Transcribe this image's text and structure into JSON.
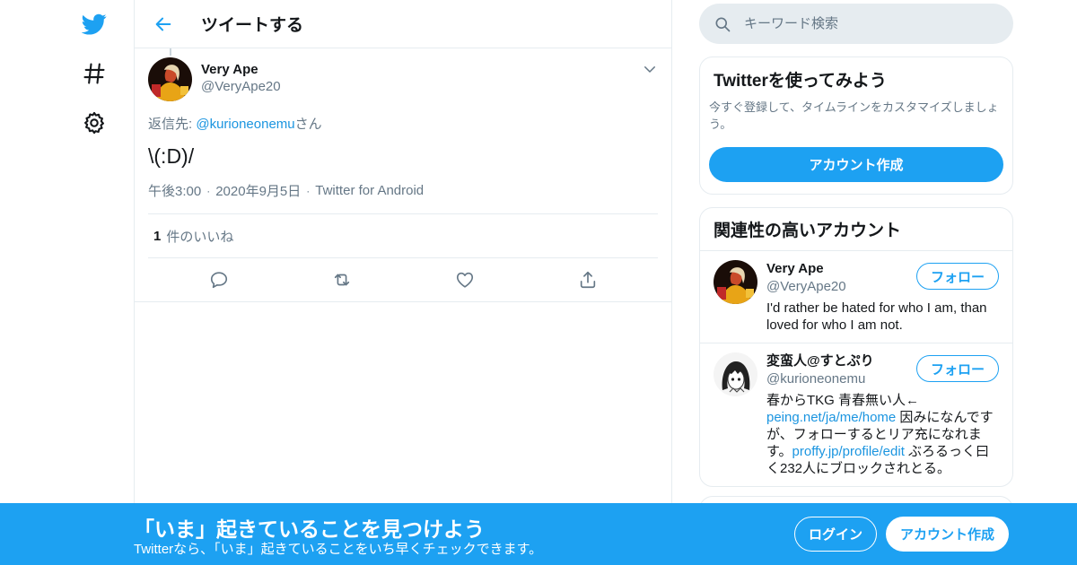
{
  "colors": {
    "accent": "#1da1f2",
    "link": "#1b95e0",
    "muted": "#657786",
    "border": "#e6ecf0"
  },
  "nav": {
    "icons": [
      "twitter-logo-icon",
      "hashtag-icon",
      "gear-icon"
    ]
  },
  "header": {
    "title": "ツイートする"
  },
  "tweet": {
    "author_name": "Very Ape",
    "author_handle": "@VeryApe20",
    "reply_prefix": "返信先: ",
    "reply_mention": "@kurioneonemu",
    "reply_suffix": "さん",
    "text": "\\(:D)/",
    "time": "午後3:00",
    "date": "2020年9月5日",
    "source": "Twitter for Android",
    "likes_count": "1",
    "likes_label": "件のいいね"
  },
  "sidebar": {
    "search_placeholder": "キーワード検索",
    "signup_card": {
      "title": "Twitterを使ってみよう",
      "description": "今すぐ登録して、タイムラインをカスタマイズしましょう。",
      "button": "アカウント作成"
    },
    "related": {
      "title": "関連性の高いアカウント",
      "accounts": [
        {
          "name": "Very Ape",
          "handle": "@VeryApe20",
          "follow_label": "フォロー",
          "bio": "I'd rather be hated for who I am, than loved for who I am not."
        },
        {
          "name": "変蛮人@すとぷり",
          "handle": "@kurioneonemu",
          "follow_label": "フォロー",
          "bio_1": "春からTKG 青春無い人←",
          "bio_link_1": "peing.net/ja/me/home",
          "bio_2": " 因みになんですが、フォローするとリア充になれます。",
          "bio_link_2": "proffy.jp/profile/edit",
          "bio_3": " ぶろるっく曰く232人にブロックされとる。"
        }
      ]
    }
  },
  "banner": {
    "title": "「いま」起きていることを見つけよう",
    "subtitle": "Twitterなら、「いま」起きていることをいち早くチェックできます。",
    "login": "ログイン",
    "signup": "アカウント作成"
  }
}
